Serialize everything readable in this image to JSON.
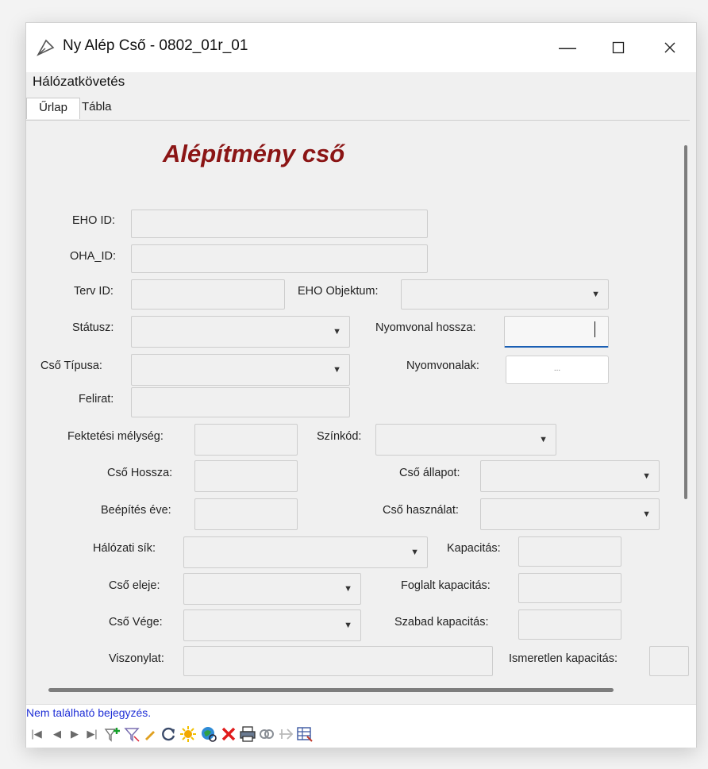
{
  "window": {
    "title": "Ny Alép Cső - 0802_01r_01"
  },
  "menu": {
    "item": "Hálózatkövetés"
  },
  "tabs": {
    "form": "Űrlap",
    "table": "Tábla"
  },
  "form": {
    "title": "Alépítmény cső",
    "labels": {
      "eho_id": "EHO ID:",
      "oha_id": "OHA_ID:",
      "terv_id": "Terv ID:",
      "eho_objektum": "EHO Objektum:",
      "statusz": "Státusz:",
      "nyomvonal_hossza": "Nyomvonal hossza:",
      "cso_tipusa": "Cső Típusa:",
      "nyomvonalak": "Nyomvonalak:",
      "felirat": "Felirat:",
      "fektetesi_melyseg": "Fektetési mélység:",
      "szinkod": "Színkód:",
      "cso_hossza": "Cső Hossza:",
      "cso_allapot": "Cső állapot:",
      "beepites_eve": "Beépítés éve:",
      "cso_hasznalat": "Cső használat:",
      "halozati_sik": "Hálózati sík:",
      "kapacitas": "Kapacitás:",
      "cso_eleje": "Cső eleje:",
      "foglalt_kapacitas": "Foglalt kapacitás:",
      "cso_vege": "Cső Vége:",
      "szabad_kapacitas": "Szabad kapacitás:",
      "viszonylat": "Viszonylat:",
      "ismeretlen_kapacitas": "Ismeretlen kapacitás:"
    },
    "nyomvonalak_button": "..."
  },
  "status": {
    "message": "Nem található bejegyzés."
  },
  "colors": {
    "title": "#8b1515",
    "status_text": "#1f2fd6",
    "focus": "#1a5fb4"
  },
  "toolbar_icons": [
    "first-record-icon",
    "prev-record-icon",
    "next-record-icon",
    "last-record-icon",
    "add-filter-icon",
    "filter-icon",
    "edit-icon",
    "refresh-icon",
    "highlight-icon",
    "zoom-to-icon",
    "delete-icon",
    "print-icon",
    "link-icon",
    "export-icon",
    "table-icon"
  ]
}
